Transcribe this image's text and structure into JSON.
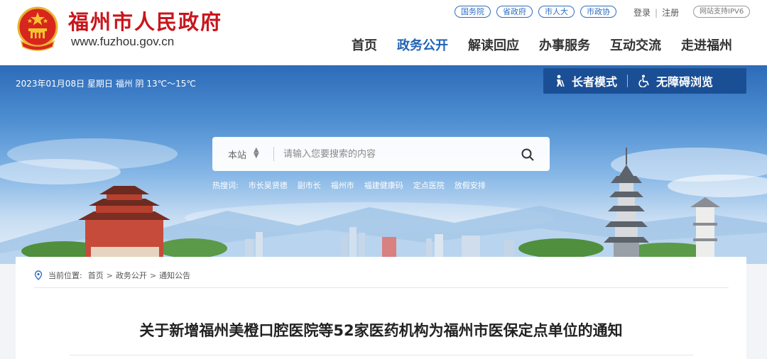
{
  "header": {
    "site_name": "福州市人民政府",
    "site_domain": "www.fuzhou.gov.cn",
    "top_links": [
      "国务院",
      "省政府",
      "市人大",
      "市政协"
    ],
    "login": "登录",
    "register": "注册",
    "ipv6_badge": "网站支持IPV6",
    "nav": [
      {
        "label": "首页",
        "active": false
      },
      {
        "label": "政务公开",
        "active": true
      },
      {
        "label": "解读回应",
        "active": false
      },
      {
        "label": "办事服务",
        "active": false
      },
      {
        "label": "互动交流",
        "active": false
      },
      {
        "label": "走进福州",
        "active": false
      }
    ],
    "brand_color": "#c8161d",
    "accent_color": "#1f63b6"
  },
  "banner": {
    "date_weather": "2023年01月08日 星期日 福州 阴 13℃～15℃",
    "elder_mode": "长者模式",
    "elder_icon": "elderly-person-icon",
    "accessible": "无障碍浏览",
    "accessible_icon": "wheelchair-icon",
    "search": {
      "scope": "本站",
      "placeholder": "请输入您要搜索的内容",
      "icon": "search-icon"
    },
    "hot_label": "热搜词:",
    "hot_keywords": [
      "市长吴贤德",
      "副市长",
      "福州市",
      "福建健康码",
      "定点医院",
      "放假安排"
    ]
  },
  "content": {
    "breadcrumb_label": "当前位置:",
    "breadcrumb": [
      "首页",
      "政务公开",
      "通知公告"
    ],
    "breadcrumb_sep": ">",
    "title": "关于新增福州美橙口腔医院等52家医药机构为福州市医保定点单位的通知"
  }
}
